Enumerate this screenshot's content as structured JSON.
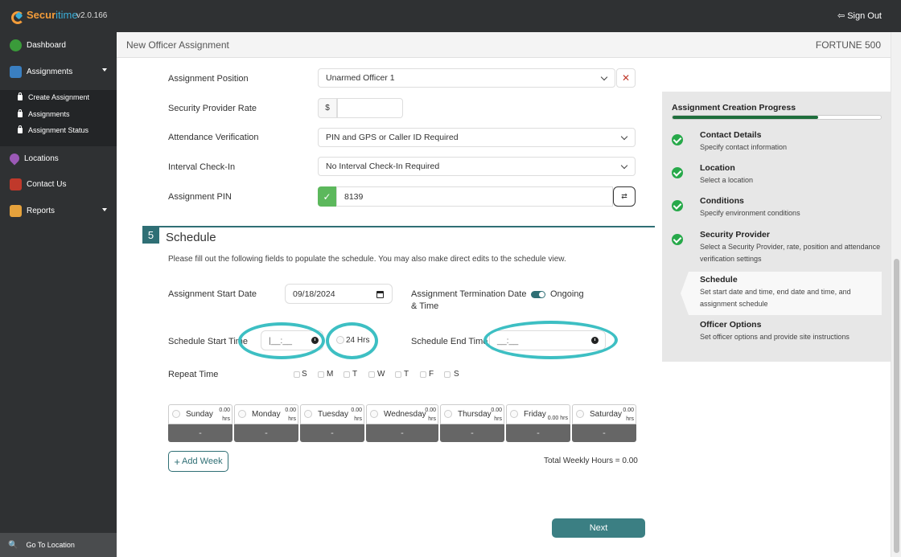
{
  "app": {
    "brand_a": "Secur",
    "brand_b": "itime",
    "version": "v2.0.166",
    "signout": "Sign Out"
  },
  "sidebar": {
    "dashboard": "Dashboard",
    "assignments": "Assignments",
    "sub": [
      "Create Assignment",
      "Assignments",
      "Assignment Status"
    ],
    "locations": "Locations",
    "contact": "Contact Us",
    "reports": "Reports",
    "goto": "Go To Location"
  },
  "header": {
    "title": "New Officer Assignment",
    "client": "FORTUNE 500"
  },
  "form": {
    "position_label": "Assignment Position",
    "position_value": "Unarmed Officer 1",
    "rate_label": "Security Provider Rate",
    "rate_prefix": "$",
    "rate_value": "",
    "attendance_label": "Attendance Verification",
    "attendance_value": "PIN and GPS or Caller ID Required",
    "interval_label": "Interval Check-In",
    "interval_value": "No Interval Check-In Required",
    "pin_label": "Assignment PIN",
    "pin_value": "8139"
  },
  "schedule": {
    "number": "5",
    "title": "Schedule",
    "desc": "Please fill out the following fields to populate the schedule. You may also make direct edits to the schedule view.",
    "start_date_label": "Assignment Start Date",
    "start_date_value": "09/18/2024",
    "term_label_1": "Assignment Termination Date",
    "term_label_2": "& Time",
    "ongoing": "Ongoing",
    "start_time_label": "Schedule Start Time",
    "start_time_value": "|__:__",
    "hrs24": "24 Hrs",
    "end_time_label": "Schedule End Time",
    "end_time_value": "__:__",
    "repeat_label": "Repeat Time",
    "repeat_days": [
      "S",
      "M",
      "T",
      "W",
      "T",
      "F",
      "S"
    ],
    "days": [
      {
        "name": "Sunday",
        "hours": "0.00",
        "unit": "hrs",
        "value": "-"
      },
      {
        "name": "Monday",
        "hours": "0.00",
        "unit": "hrs",
        "value": "-"
      },
      {
        "name": "Tuesday",
        "hours": "0.00",
        "unit": "hrs",
        "value": "-"
      },
      {
        "name": "Wednesday",
        "hours": "0.00",
        "unit": "hrs",
        "value": "-"
      },
      {
        "name": "Thursday",
        "hours": "0.00",
        "unit": "hrs",
        "value": "-"
      },
      {
        "name": "Friday",
        "hours": "0.00 hrs",
        "unit": "",
        "value": "-"
      },
      {
        "name": "Saturday",
        "hours": "0.00",
        "unit": "hrs",
        "value": "-"
      }
    ],
    "add_week": "Add Week",
    "total": "Total Weekly Hours = 0.00",
    "next": "Next"
  },
  "progress": {
    "title": "Assignment Creation Progress",
    "fraction": 0.7,
    "steps": [
      {
        "title": "Contact Details",
        "desc": "Specify contact information",
        "done": true
      },
      {
        "title": "Location",
        "desc": "Select a location",
        "done": true
      },
      {
        "title": "Conditions",
        "desc": "Specify environment conditions",
        "done": true
      },
      {
        "title": "Security Provider",
        "desc": "Select a Security Provider, rate, position and attendance verification settings",
        "done": true
      },
      {
        "title": "Schedule",
        "desc": "Set start date and time, end date and time, and assignment schedule",
        "done": false
      },
      {
        "title": "Officer Options",
        "desc": "Set officer options and provide site instructions",
        "done": false
      }
    ]
  },
  "colors": {
    "accent": "#2f6f75",
    "highlight": "#3dbfc3",
    "progress": "#1e6e3c",
    "sidebar": "#2f3133"
  }
}
